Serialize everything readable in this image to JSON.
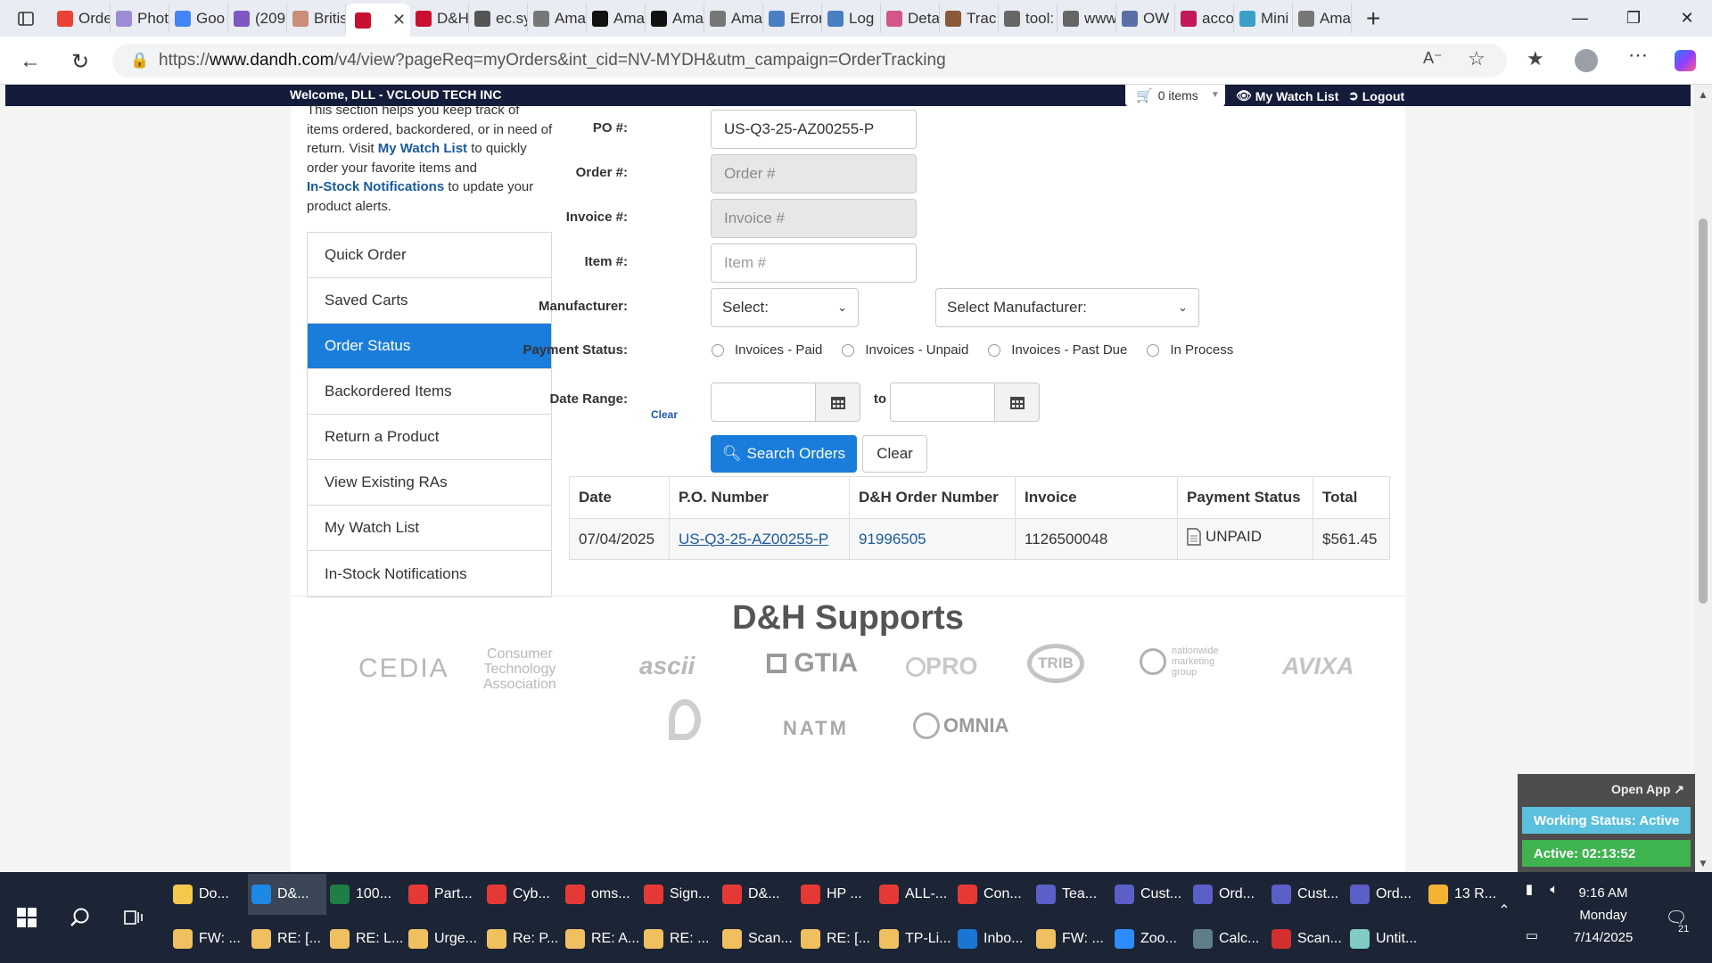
{
  "browser": {
    "tabs": [
      {
        "label": "Orde",
        "color": "#ea4335"
      },
      {
        "label": "Phot",
        "color": "#9c8cd6"
      },
      {
        "label": "Goo",
        "color": "#4285f4"
      },
      {
        "label": "(209",
        "color": "#7e57c2"
      },
      {
        "label": "Britis",
        "color": "#c98d7a"
      },
      {
        "label": "",
        "color": "#c8102e",
        "active": true
      },
      {
        "label": "D&H",
        "color": "#c8102e"
      },
      {
        "label": "ec.sy",
        "color": "#555555"
      },
      {
        "label": "Ama",
        "color": "#777777"
      },
      {
        "label": "Ama",
        "color": "#111111"
      },
      {
        "label": "Ama",
        "color": "#111111"
      },
      {
        "label": "Ama",
        "color": "#777777"
      },
      {
        "label": "Error",
        "color": "#4a7fc1"
      },
      {
        "label": "Log",
        "color": "#4a7fc1"
      },
      {
        "label": "Deta",
        "color": "#d1568c"
      },
      {
        "label": "Trac",
        "color": "#8a5a3b"
      },
      {
        "label": "tool:",
        "color": "#666666"
      },
      {
        "label": "www",
        "color": "#666666"
      },
      {
        "label": "OW",
        "color": "#5a6ea8"
      },
      {
        "label": "acco",
        "color": "#c2185b"
      },
      {
        "label": "Mini",
        "color": "#3aa0c8"
      },
      {
        "label": "Ama",
        "color": "#777777"
      }
    ],
    "url_prefix": "https://",
    "url_host": "www.dandh.com",
    "url_rest": "/v4/view?pageReq=myOrders&int_cid=NV-MYDH&utm_campaign=OrderTracking"
  },
  "site": {
    "welcome": "Welcome, DLL - VCLOUD TECH INC",
    "cart_label": "0 items",
    "watchlist_label": "My Watch List",
    "logout_label": "Logout",
    "intro": {
      "line1": "This section helps you keep track of",
      "line2": "items ordered, backordered, or in need of",
      "line3a": "return. Visit ",
      "line3link": "My Watch List",
      "line3b": " to quickly",
      "line4": "order your favorite items and",
      "line5link": "In-Stock Notifications",
      "line5b": " to update your",
      "line6": "product alerts."
    },
    "menu": [
      {
        "label": "Quick Order"
      },
      {
        "label": "Saved Carts"
      },
      {
        "label": "Order Status",
        "active": true
      },
      {
        "label": "Backordered Items"
      },
      {
        "label": "Return a Product"
      },
      {
        "label": "View Existing RAs"
      },
      {
        "label": "My Watch List"
      },
      {
        "label": "In-Stock Notifications"
      }
    ],
    "form": {
      "po_label": "PO #:",
      "po_value": "US-Q3-25-AZ00255-P",
      "order_label": "Order #:",
      "order_placeholder": "Order #",
      "invoice_label": "Invoice #:",
      "invoice_placeholder": "Invoice #",
      "item_label": "Item #:",
      "item_placeholder": "Item #",
      "manufacturer_label": "Manufacturer:",
      "manufacturer_select1": "Select:",
      "manufacturer_select2": "Select Manufacturer:",
      "payment_label": "Payment Status:",
      "payment_options": [
        "Invoices - Paid",
        "Invoices - Unpaid",
        "Invoices - Past Due",
        "In Process"
      ],
      "date_label": "Date Range:",
      "date_clear": "Clear",
      "date_to": "to",
      "search_button": "Search Orders",
      "clear_button": "Clear"
    },
    "table": {
      "headers": [
        "Date",
        "P.O. Number",
        "D&H Order Number",
        "Invoice",
        "Payment Status",
        "Total"
      ],
      "rows": [
        {
          "date": "07/04/2025",
          "po": "US-Q3-25-AZ00255-P",
          "order": "91996505",
          "invoice": "1126500048",
          "status": "UNPAID",
          "total": "$561.45"
        }
      ]
    },
    "supports_title": "D&H Supports",
    "logos": [
      {
        "name": "CEDIA"
      },
      {
        "line1": "Consumer",
        "line2": "Technology",
        "line3": "Association"
      },
      {
        "name": "ascii"
      },
      {
        "name": "GTIA"
      },
      {
        "name": "PRO"
      },
      {
        "name": "TRIB"
      },
      {
        "line1": "nationwide",
        "line2": "marketing",
        "line3": "group"
      },
      {
        "name": "AVIXA"
      },
      {
        "name": "NATM"
      },
      {
        "name": "OMNIA"
      }
    ]
  },
  "popup": {
    "open_app": "Open App ↗",
    "working_status": "Working Status: Active",
    "active_timer": "Active: 02:13:52"
  },
  "taskbar": {
    "row1": [
      {
        "label": "Do...",
        "color": "#f2c94c"
      },
      {
        "label": "D&...",
        "color": "#1e88e5",
        "active": true
      },
      {
        "label": "100...",
        "color": "#1e7e45"
      },
      {
        "label": "Part...",
        "color": "#e53935"
      },
      {
        "label": "Cyb...",
        "color": "#e53935"
      },
      {
        "label": "oms...",
        "color": "#e53935"
      },
      {
        "label": "Sign...",
        "color": "#e53935"
      },
      {
        "label": "D&...",
        "color": "#e53935"
      },
      {
        "label": "HP ...",
        "color": "#e53935"
      },
      {
        "label": "ALL-...",
        "color": "#e53935"
      },
      {
        "label": "Con...",
        "color": "#e53935"
      },
      {
        "label": "Tea...",
        "color": "#5b5fc7"
      },
      {
        "label": "Cust...",
        "color": "#5b5fc7"
      },
      {
        "label": "Ord...",
        "color": "#5b5fc7"
      },
      {
        "label": "Cust...",
        "color": "#5b5fc7"
      },
      {
        "label": "Ord...",
        "color": "#5b5fc7"
      },
      {
        "label": "13 R...",
        "color": "#f2b233"
      }
    ],
    "row2": [
      {
        "label": "FW: ...",
        "color": "#f0c060"
      },
      {
        "label": "RE: [...",
        "color": "#f0c060"
      },
      {
        "label": "RE: L...",
        "color": "#f0c060"
      },
      {
        "label": "Urge...",
        "color": "#f0c060"
      },
      {
        "label": "Re: P...",
        "color": "#f0c060"
      },
      {
        "label": "RE: A...",
        "color": "#f0c060"
      },
      {
        "label": "RE: ...",
        "color": "#f0c060"
      },
      {
        "label": "Scan...",
        "color": "#f0c060"
      },
      {
        "label": "RE: [...",
        "color": "#f0c060"
      },
      {
        "label": "TP-Li...",
        "color": "#f0c060"
      },
      {
        "label": "Inbo...",
        "color": "#1976d2"
      },
      {
        "label": "FW: ...",
        "color": "#f0c060"
      },
      {
        "label": "Zoo...",
        "color": "#2d8cff"
      },
      {
        "label": "Calc...",
        "color": "#607d8b"
      },
      {
        "label": "Scan...",
        "color": "#d32f2f"
      },
      {
        "label": "Untit...",
        "color": "#80cbc4"
      }
    ],
    "time": "9:16 AM",
    "day": "Monday",
    "date": "7/14/2025",
    "notif_count": "21"
  }
}
